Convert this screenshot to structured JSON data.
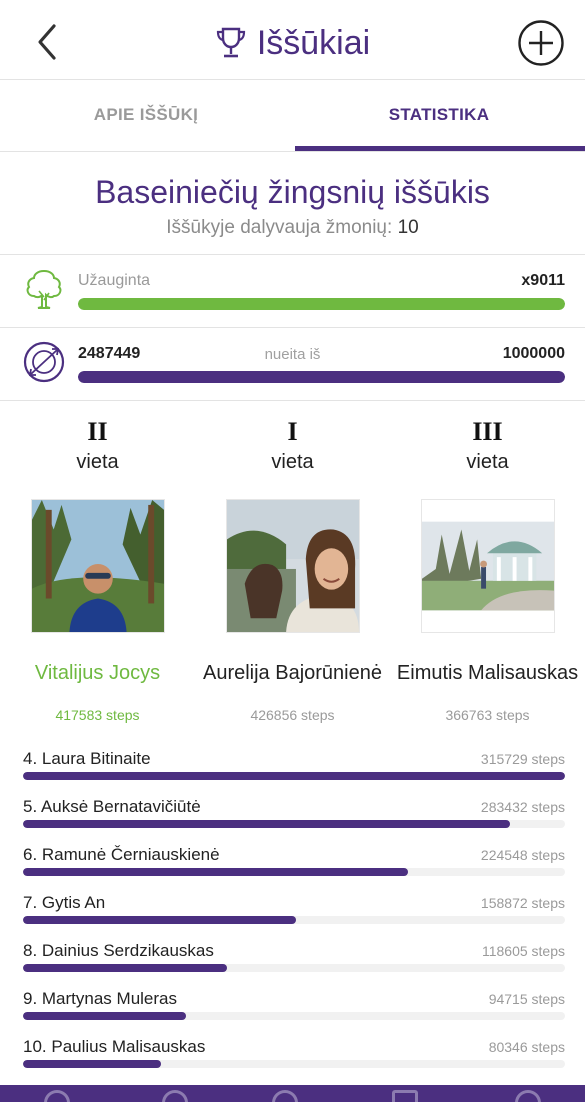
{
  "header": {
    "title": "Iššūkiai",
    "back_icon": "chevron-left-icon",
    "title_icon": "trophy-icon",
    "add_icon": "plus-circle-icon"
  },
  "tabs": [
    {
      "label": "APIE IŠŠŪKĮ",
      "active": false
    },
    {
      "label": "STATISTIKA",
      "active": true
    }
  ],
  "challenge": {
    "name": "Baseiniečių žingsnių iššūkis",
    "participants_label": "Iššūkyje dalyvauja žmonių:",
    "participants_count": "10"
  },
  "trees": {
    "icon": "tree-icon",
    "label": "Užauginta",
    "value": "x9011",
    "progress": 1.0
  },
  "steps_goal": {
    "icon": "globe-orbit-icon",
    "current": "2487449",
    "middle_label": "nueita iš",
    "goal": "1000000",
    "progress": 1.0
  },
  "podium": [
    {
      "roman": "II",
      "vieta": "vieta",
      "name": "Vitalijus Jocys",
      "steps": "417583 steps",
      "highlight": true
    },
    {
      "roman": "I",
      "vieta": "vieta",
      "name": "Aurelija Bajorūnienė",
      "steps": "426856 steps",
      "highlight": false
    },
    {
      "roman": "III",
      "vieta": "vieta",
      "name": "Eimutis Malisauskas",
      "steps": "366763 steps",
      "highlight": false
    }
  ],
  "ranking": [
    {
      "label": "4. Laura Bitinaite",
      "steps": "315729 steps",
      "progress": 1.0
    },
    {
      "label": "5. Auksė Bernatavičiūtė",
      "steps": "283432 steps",
      "progress": 0.898
    },
    {
      "label": "6. Ramunė Černiauskienė",
      "steps": "224548 steps",
      "progress": 0.711
    },
    {
      "label": "7. Gytis An",
      "steps": "158872 steps",
      "progress": 0.503
    },
    {
      "label": "8. Dainius Serdzikauskas",
      "steps": "118605 steps",
      "progress": 0.376
    },
    {
      "label": "9. Martynas Muleras",
      "steps": "94715 steps",
      "progress": 0.3
    },
    {
      "label": "10. Paulius Malisauskas",
      "steps": "80346 steps",
      "progress": 0.254
    }
  ],
  "colors": {
    "brand_purple": "#4b2f80",
    "accent_green": "#6fb940"
  }
}
